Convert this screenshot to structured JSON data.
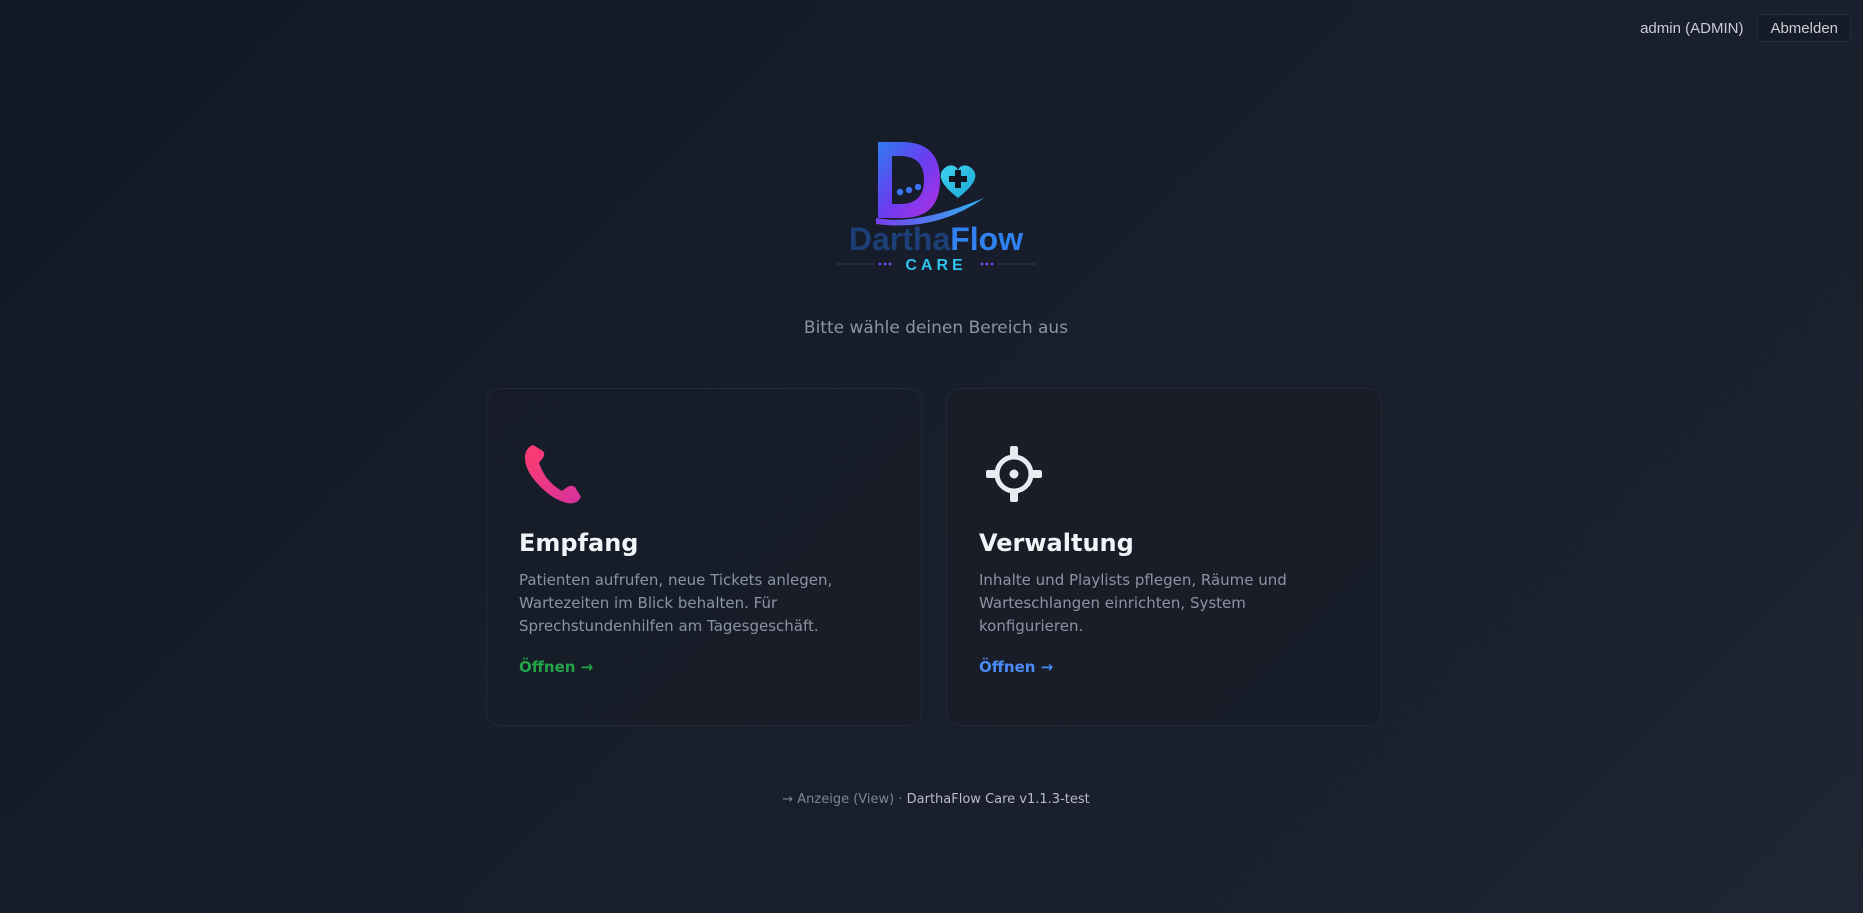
{
  "header": {
    "user": "admin (ADMIN)",
    "logout_label": "Abmelden"
  },
  "logo": {
    "brand_part1": "Dartha",
    "brand_part2": "Flow",
    "brand_sub": "CARE"
  },
  "subtitle": "Bitte wähle deinen Bereich aus",
  "cards": [
    {
      "icon": "phone-icon",
      "title": "Empfang",
      "description": "Patienten aufrufen, neue Tickets anlegen, Wartezeiten im Blick behalten. Für Sprechstundenhilfen am Tagesgeschäft.",
      "link_label": "Öffnen →",
      "link_color": "#22a447"
    },
    {
      "icon": "gear-icon",
      "title": "Verwaltung",
      "description": "Inhalte und Playlists pflegen, Räume und Warteschlangen einrichten, System konfigurieren.",
      "link_label": "Öffnen →",
      "link_color": "#4b8bf7"
    }
  ],
  "footer": {
    "view_link": "→ Anzeige (View)",
    "separator": "·",
    "version": "DarthaFlow Care v1.1.3-test"
  }
}
